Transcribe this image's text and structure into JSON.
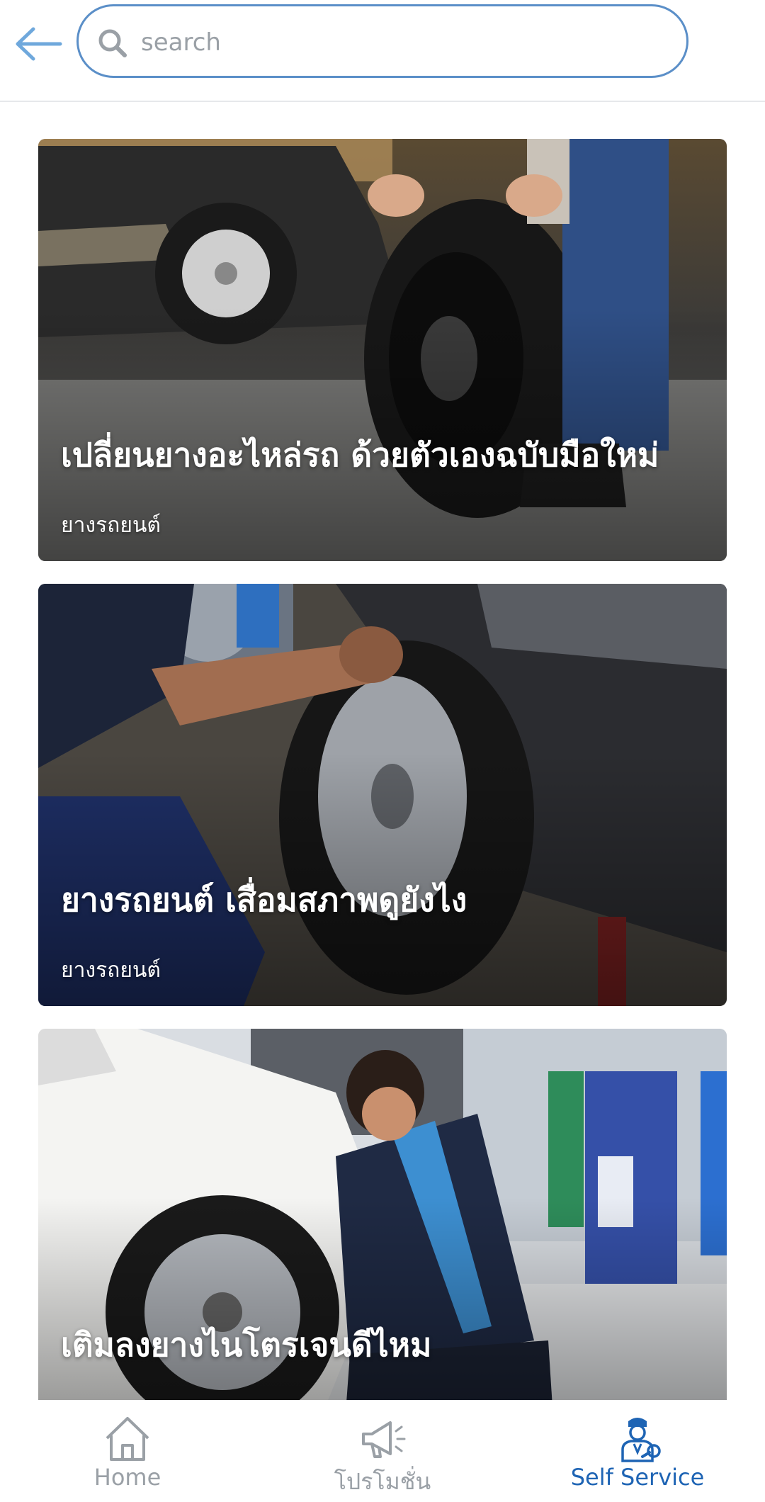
{
  "header": {
    "search_placeholder": "search",
    "back_icon": "arrow-left-icon",
    "search_icon": "search-icon"
  },
  "cards": [
    {
      "title": "เปลี่ยนยางอะไหล่รถ ด้วยตัวเองฉบับมือใหม่",
      "category": "ยางรถยนต์",
      "image": "person-rolling-tire-photo"
    },
    {
      "title": "ยางรถยนต์ เสื่อมสภาพดูยังไง",
      "category": "ยางรถยนต์",
      "image": "mechanic-checking-wheel-photo"
    },
    {
      "title": "เติมลงยางไนโตรเจนดีไหม",
      "category": "",
      "image": "technician-nitrogen-tire-photo"
    }
  ],
  "nav": {
    "items": [
      {
        "label": "Home",
        "icon": "home-icon",
        "active": false
      },
      {
        "label": "โปรโมชั่น",
        "icon": "megaphone-icon",
        "active": false
      },
      {
        "label": "Self Service",
        "icon": "mechanic-icon",
        "active": true
      }
    ]
  },
  "colors": {
    "accent": "#1e64b4",
    "search_border": "#5b8fc8",
    "inactive": "#9aa0a6"
  }
}
